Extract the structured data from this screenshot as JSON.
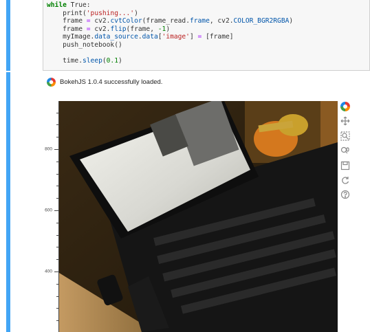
{
  "code_cell": {
    "line1": {
      "kw": "while",
      "rest": " True:"
    },
    "line2": {
      "pre": "    print(",
      "str": "'pushing...'",
      "post": ")"
    },
    "line3": {
      "pre": "    frame ",
      "op": "=",
      "mid": " cv2.",
      "attr1": "cvtColor",
      "mid2": "(frame_read.",
      "attr2": "frame",
      "mid3": ", cv2.",
      "attr3": "COLOR_BGR2RGBA",
      "post": ")"
    },
    "line4": {
      "pre": "    frame ",
      "op": "=",
      "mid": " cv2.",
      "attr1": "flip",
      "mid2": "(frame, ",
      "num": "-1",
      "post": ")"
    },
    "line5": {
      "pre": "    myImage.",
      "attr1": "data_source",
      "mid": ".",
      "attr2": "data",
      "mid2": "[",
      "str": "'image'",
      "mid3": "] ",
      "op": "=",
      "post": " [frame]"
    },
    "line6": "    push_notebook()",
    "line7": "",
    "line8": {
      "pre": "    time.",
      "attr1": "sleep",
      "mid": "(",
      "num": "0.1",
      "post": ")"
    }
  },
  "output": {
    "bokeh_message": "BokehJS 1.0.4 successfully loaded."
  },
  "plot": {
    "y_ticks": [
      "800",
      "600",
      "400"
    ]
  },
  "toolbar": {
    "tools": [
      "bokeh-logo",
      "pan-icon",
      "box-zoom-icon",
      "wheel-zoom-icon",
      "save-icon",
      "reset-icon",
      "help-icon"
    ]
  },
  "colors": {
    "cell_bar": "#42a5f5",
    "bokeh_logo": [
      "#e53935",
      "#fb8c00",
      "#43a047",
      "#1e88e5"
    ]
  }
}
